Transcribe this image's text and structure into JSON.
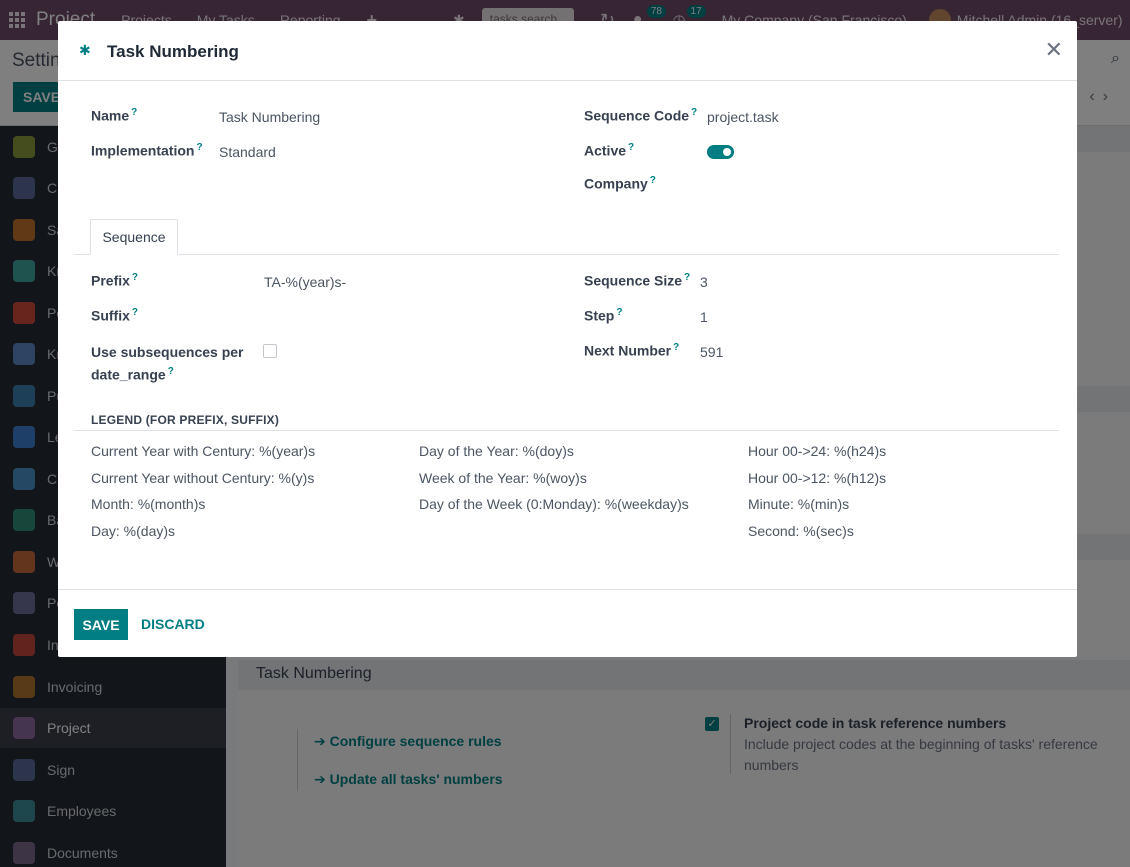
{
  "topbar": {
    "brand": "Project",
    "nav": [
      "Projects",
      "My Tasks",
      "Reporting"
    ],
    "search_placeholder": "tasks search",
    "messages_count": "78",
    "activities_count": "17",
    "company": "My Company (San Francisco)",
    "user": "Mitchell Admin (16_server)"
  },
  "subheader": {
    "title": "Settings",
    "save_label": "SAVE"
  },
  "sidebar": {
    "items": [
      {
        "label": "General Settings",
        "color": "#8a9a3b"
      },
      {
        "label": "CRM",
        "color": "#5b6a9b"
      },
      {
        "label": "Sales",
        "color": "#c0732f"
      },
      {
        "label": "Knowledge",
        "color": "#3fa7a0"
      },
      {
        "label": "Point of Sale",
        "color": "#d14b3a"
      },
      {
        "label": "Knowledge",
        "color": "#5b8bc7"
      },
      {
        "label": "Purchase",
        "color": "#3a7fb0"
      },
      {
        "label": "Leaves",
        "color": "#3a7fd0"
      },
      {
        "label": "Cloud",
        "color": "#4a90c8"
      },
      {
        "label": "Barcode",
        "color": "#2f8f74"
      },
      {
        "label": "Website",
        "color": "#c76a3a"
      },
      {
        "label": "Point of Sale",
        "color": "#6d6d9a"
      },
      {
        "label": "Inventory",
        "color": "#c0463a"
      },
      {
        "label": "Invoicing",
        "color": "#b0752f"
      },
      {
        "label": "Project",
        "color": "#8a6aa0"
      },
      {
        "label": "Sign",
        "color": "#5b6a9b"
      },
      {
        "label": "Employees",
        "color": "#3a8f9a"
      },
      {
        "label": "Documents",
        "color": "#7a6b8a"
      }
    ]
  },
  "background": {
    "task_numbering_header": "Task Numbering",
    "configure_link": "Configure sequence rules",
    "update_link": "Update all tasks' numbers",
    "option_title": "Project code in task reference numbers",
    "option_desc": "Include project codes at the beginning of tasks' reference numbers"
  },
  "modal": {
    "title": "Task Numbering",
    "fields": {
      "name_label": "Name",
      "name_value": "Task Numbering",
      "implementation_label": "Implementation",
      "implementation_value": "Standard",
      "sequence_code_label": "Sequence Code",
      "sequence_code_value": "project.task",
      "active_label": "Active",
      "active_value": true,
      "company_label": "Company",
      "company_value": ""
    },
    "tab_label": "Sequence",
    "sequence": {
      "prefix_label": "Prefix",
      "prefix_value": "TA-%(year)s-",
      "suffix_label": "Suffix",
      "suffix_value": "",
      "subseq_label": "Use subsequences per date_range",
      "subseq_checked": false,
      "size_label": "Sequence Size",
      "size_value": "3",
      "step_label": "Step",
      "step_value": "1",
      "next_label": "Next Number",
      "next_value": "591"
    },
    "legend": {
      "title": "LEGEND (FOR PREFIX, SUFFIX)",
      "col1": [
        "Current Year with Century: %(year)s",
        "Current Year without Century: %(y)s",
        "Month: %(month)s",
        "Day: %(day)s"
      ],
      "col2": [
        "Day of the Year: %(doy)s",
        "Week of the Year: %(woy)s",
        "Day of the Week (0:Monday): %(weekday)s"
      ],
      "col3": [
        "Hour 00->24: %(h24)s",
        "Hour 00->12: %(h12)s",
        "Minute: %(min)s",
        "Second: %(sec)s"
      ]
    },
    "footer": {
      "save_label": "SAVE",
      "discard_label": "DISCARD"
    }
  }
}
